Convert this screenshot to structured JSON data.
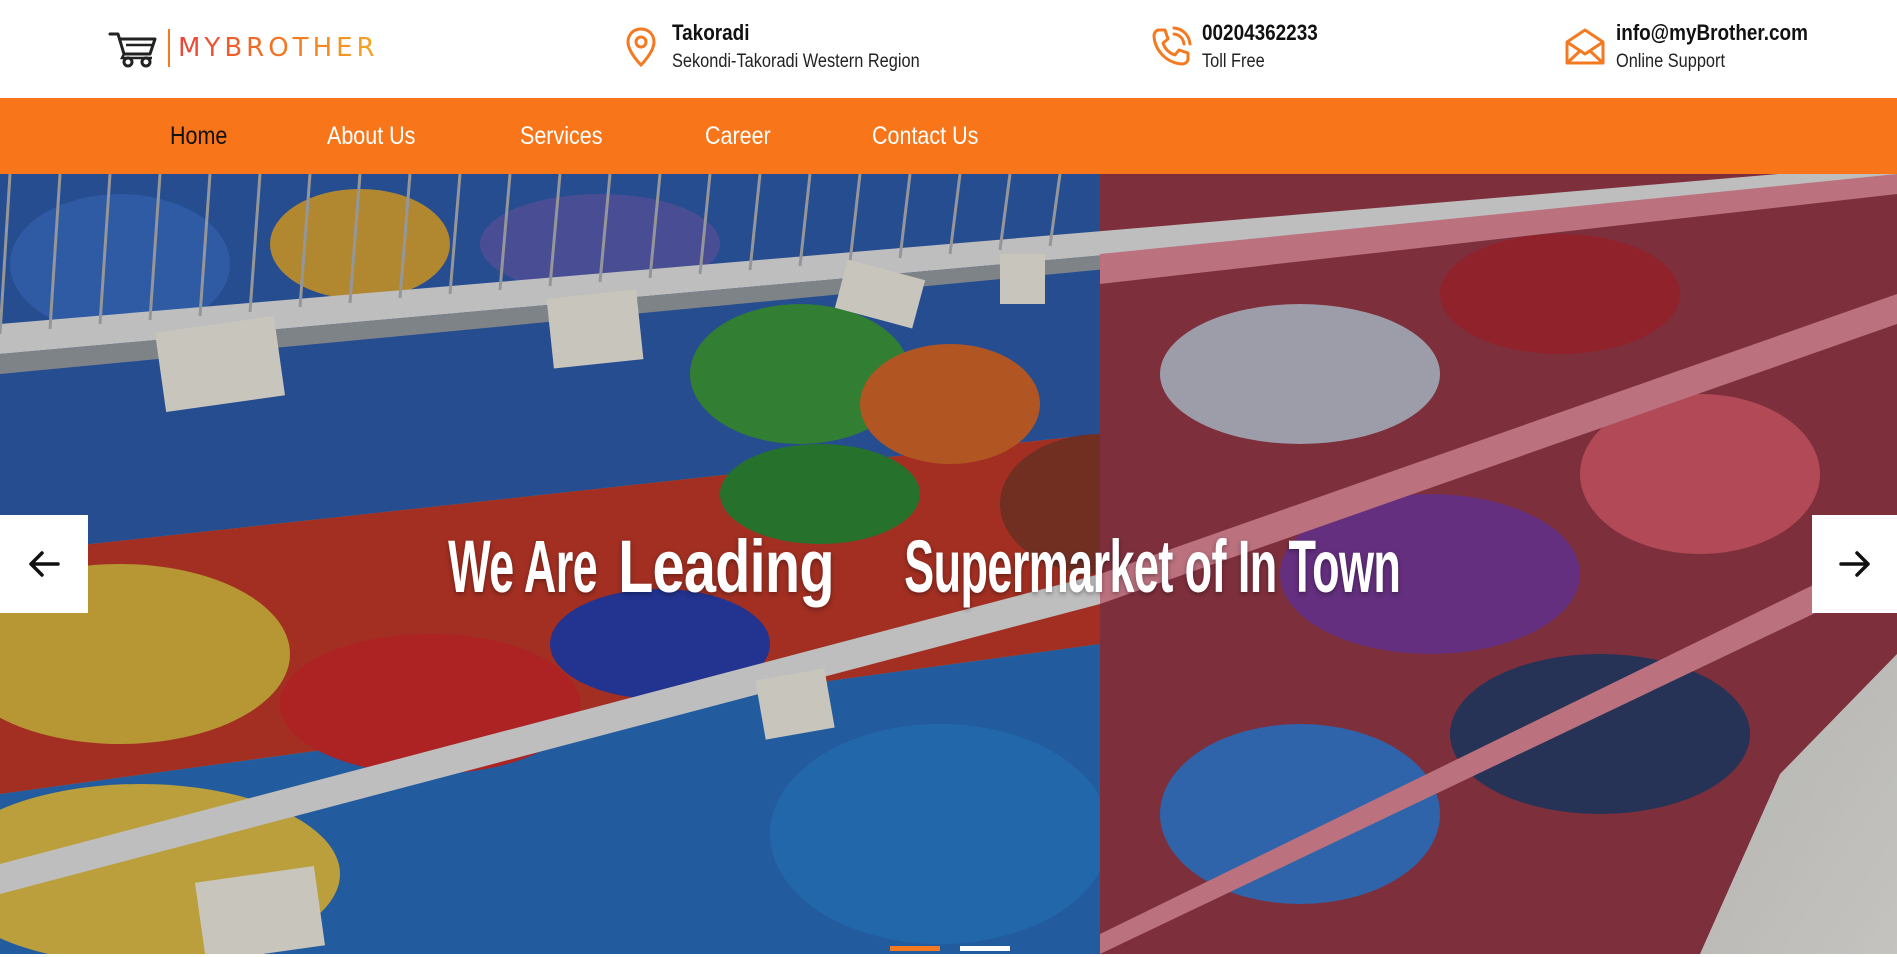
{
  "brand": {
    "name": "MYBROTHER"
  },
  "contact": {
    "location_title": "Takoradi",
    "location_sub": "Sekondi-Takoradi Western Region",
    "phone": "00204362233",
    "phone_sub": "Toll Free",
    "email": "info@myBrother.com",
    "email_sub": "Online Support"
  },
  "nav": {
    "items": [
      {
        "label": "Home",
        "active": true
      },
      {
        "label": "About Us"
      },
      {
        "label": "Services"
      },
      {
        "label": "Career"
      },
      {
        "label": "Contact Us"
      }
    ]
  },
  "hero": {
    "headline_pre": "We Are ",
    "headline_bold": "Leading",
    "headline_post": " Supermarket of In Town",
    "slides": 2,
    "active_slide": 1
  },
  "colors": {
    "accent": "#f87519",
    "text": "#111111",
    "white": "#ffffff"
  },
  "icons": {
    "logo": "shopping-cart-icon",
    "location": "map-pin-icon",
    "phone": "phone-icon",
    "email": "envelope-icon",
    "prev": "arrow-left-icon",
    "next": "arrow-right-icon"
  }
}
